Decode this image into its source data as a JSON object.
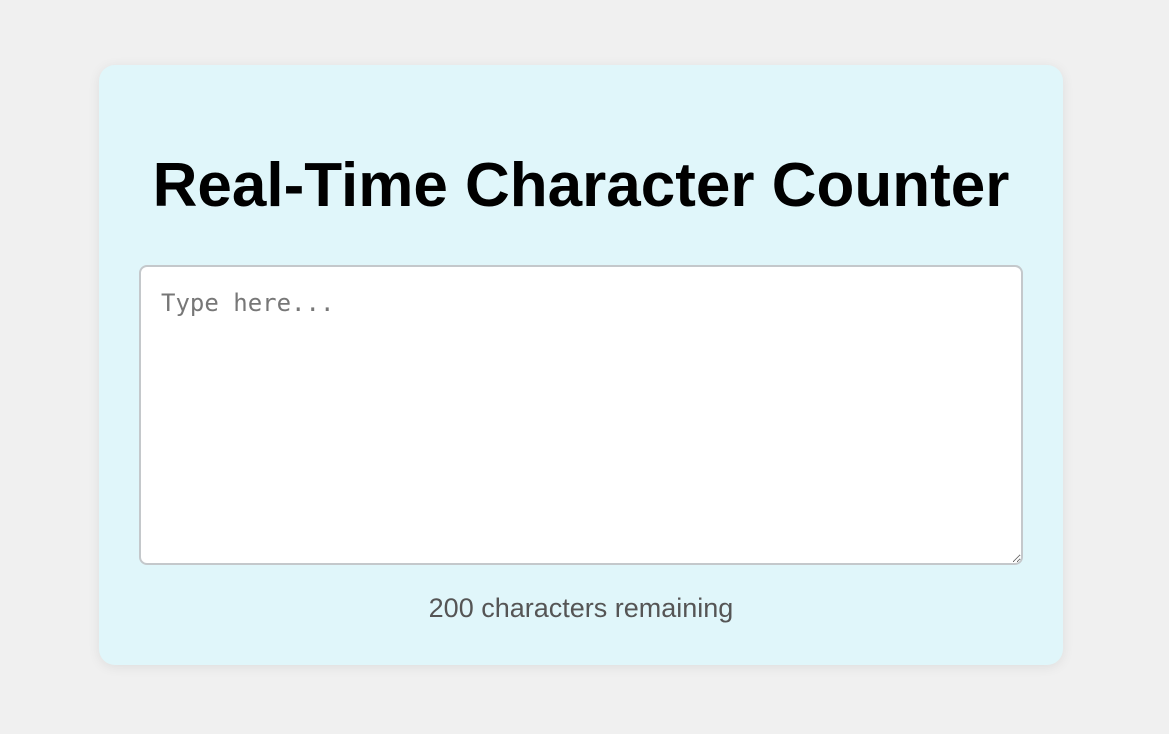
{
  "app": {
    "title": "Real-Time Character Counter"
  },
  "editor": {
    "placeholder": "Type here...",
    "value": ""
  },
  "counter": {
    "text": "200 characters remaining"
  },
  "colors": {
    "page_background": "#f0f0f0",
    "card_background": "#e0f6fa",
    "title_text": "#000000",
    "counter_text": "#555555",
    "editor_border": "#c4c8cb"
  }
}
